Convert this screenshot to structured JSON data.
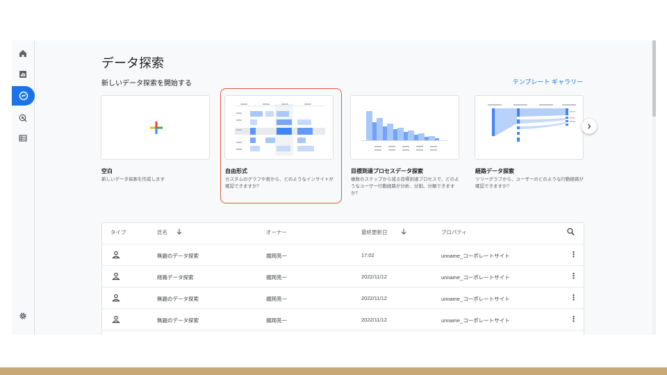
{
  "page": {
    "title": "データ探索",
    "subtitle": "新しいデータ探索を開始する",
    "gallery_link": "テンプレート ギャラリー"
  },
  "rail": {
    "items": [
      "home-icon",
      "reports-icon",
      "explore-icon",
      "advertising-icon",
      "configure-icon"
    ],
    "settings": "gear-icon"
  },
  "cards": [
    {
      "title": "空白",
      "desc": "新しいデータ探索を作成します"
    },
    {
      "title": "自由形式",
      "desc": "カスタムのグラフや表から、どのようなインサイトが確認できますか？"
    },
    {
      "title": "目標到達プロセスデータ探索",
      "desc": "複数のステップから成る目標到達プロセスで、どのようなユーザー行動経路が分析、分割、分類できますか？"
    },
    {
      "title": "経路データ探索",
      "desc": "ツリーグラフから、ユーザーのどのような行動経路が確認できますか？"
    }
  ],
  "table": {
    "headers": {
      "type": "タイプ",
      "name": "氏名",
      "owner": "オーナー",
      "updated": "最終更新日",
      "property": "プロパティ"
    },
    "rows": [
      {
        "name": "無題のデータ探索",
        "owner": "梶岡亮一",
        "updated": "17:02",
        "property": "unname_コーポレートサイト"
      },
      {
        "name": "経路データ探索",
        "owner": "梶岡亮一",
        "updated": "2022/11/12",
        "property": "unname_コーポレートサイト"
      },
      {
        "name": "無題のデータ探索",
        "owner": "梶岡亮一",
        "updated": "2022/11/12",
        "property": "unname_コーポレートサイト"
      },
      {
        "name": "無題のデータ探索",
        "owner": "梶岡亮一",
        "updated": "2022/11/12",
        "property": "unname_コーポレートサイト"
      }
    ]
  },
  "colors": {
    "accent": "#1a73e8",
    "highlight": "#e8543e",
    "bottom_bar": "#c9a877"
  }
}
